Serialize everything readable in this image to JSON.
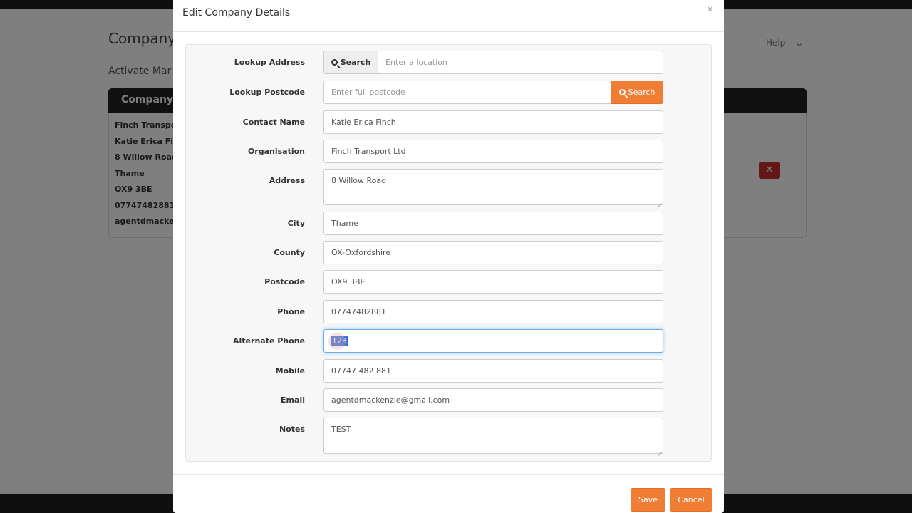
{
  "background": {
    "page_title": "Company",
    "subtitle": "Activate Mar",
    "help_label": "Help",
    "panel_title": "Company",
    "info_lines": [
      "Finch Transpor",
      "Katie Erica Fin",
      "8 Willow Road",
      "Thame",
      "OX9 3BE",
      "07747482881",
      "agentdmacker"
    ]
  },
  "modal": {
    "title": "Edit Company Details",
    "close_glyph": "×",
    "lookup_address": {
      "label": "Lookup Address",
      "button": "Search",
      "placeholder": "Enter a location"
    },
    "lookup_postcode": {
      "label": "Lookup Postcode",
      "placeholder": "Enter full postcode",
      "button": "Search"
    },
    "fields": {
      "contact_name": {
        "label": "Contact Name",
        "value": "Katie Erica Finch"
      },
      "organisation": {
        "label": "Organisation",
        "value": "Finch Transport Ltd"
      },
      "address": {
        "label": "Address",
        "value": "8 Willow Road"
      },
      "city": {
        "label": "City",
        "value": "Thame"
      },
      "county": {
        "label": "County",
        "value": "OX-Oxfordshire"
      },
      "postcode": {
        "label": "Postcode",
        "value": "OX9 3BE"
      },
      "phone": {
        "label": "Phone",
        "value": "07747482881"
      },
      "alternate_phone": {
        "label": "Alternate Phone",
        "value": "123"
      },
      "mobile": {
        "label": "Mobile",
        "value": "07747 482 881"
      },
      "email": {
        "label": "Email",
        "value": "agentdmackenzie@gmail.com"
      },
      "notes": {
        "label": "Notes",
        "value": "TEST"
      }
    },
    "save_label": "Save",
    "cancel_label": "Cancel"
  },
  "colors": {
    "accent": "#ef7d33",
    "focus": "#66afe9",
    "selection": "#3874d8"
  }
}
